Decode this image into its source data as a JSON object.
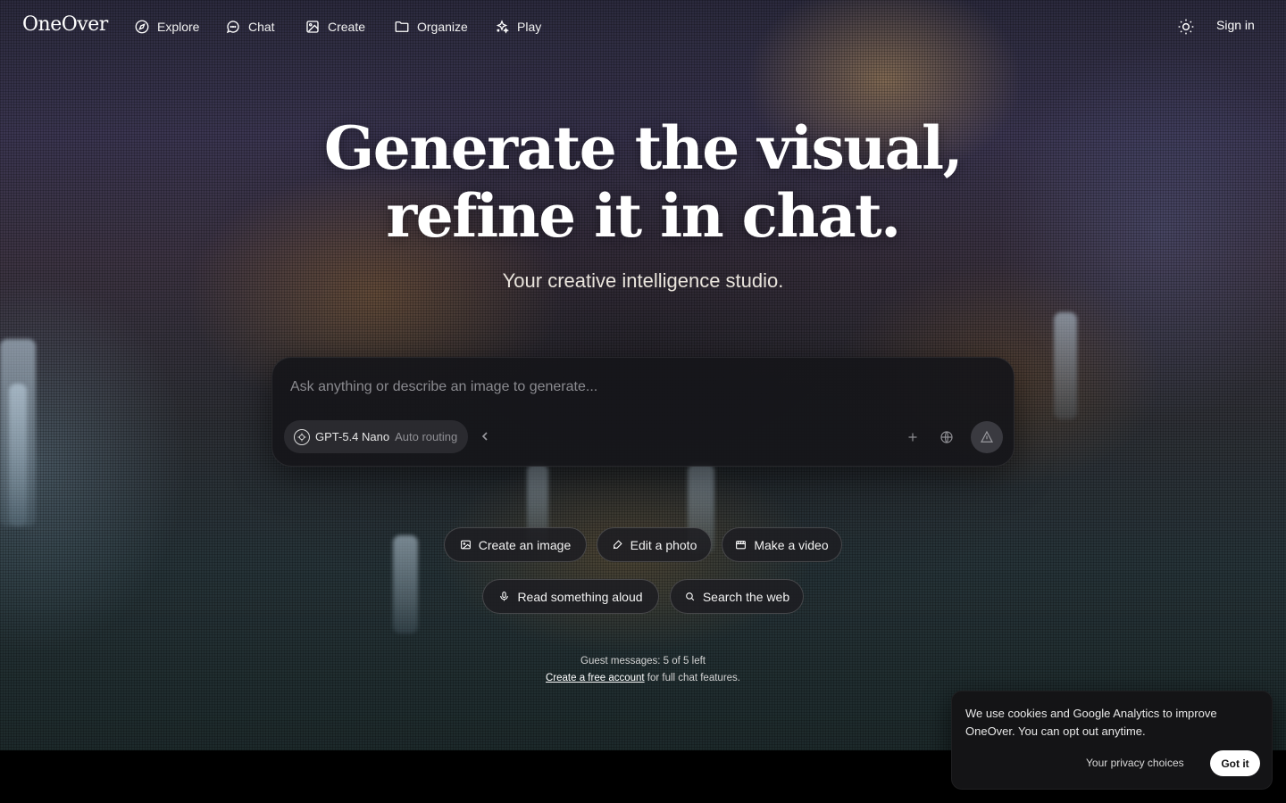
{
  "nav": {
    "logo": "OneOver",
    "items": [
      {
        "label": "Explore",
        "icon": "compass-icon"
      },
      {
        "label": "Chat",
        "icon": "chat-bubble-icon"
      },
      {
        "label": "Create",
        "icon": "image-icon"
      },
      {
        "label": "Organize",
        "icon": "folder-icon"
      },
      {
        "label": "Play",
        "icon": "sparkles-icon"
      }
    ],
    "theme_icon": "sun-icon",
    "signin_label": "Sign in"
  },
  "hero": {
    "headline_line1": "Generate the visual,",
    "headline_line2": "refine it in chat.",
    "subhead": "Your creative intelligence studio."
  },
  "composer": {
    "placeholder": "Ask anything or describe an image to generate...",
    "value": "",
    "model_name": "GPT-5.4 Nano",
    "model_routing": "Auto routing"
  },
  "chips": {
    "create_image": "Create an image",
    "edit_photo": "Edit a photo",
    "make_video": "Make a video",
    "read_aloud": "Read something aloud",
    "search_web": "Search the web"
  },
  "guest": {
    "messages": "Guest messages: 5 of 5 left",
    "link": "Create a free account",
    "suffix": "for full chat features."
  },
  "cookie": {
    "text": "We use cookies and Google Analytics to improve OneOver. You can opt out anytime.",
    "privacy_label": "Your privacy choices",
    "accept_label": "Got it"
  }
}
